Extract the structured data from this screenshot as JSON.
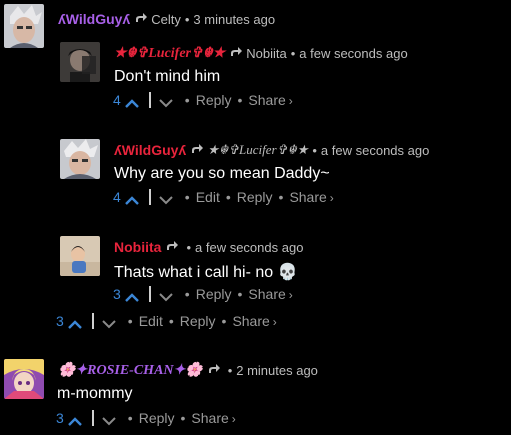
{
  "colors": {
    "accent_purple": "#a860e8",
    "accent_red": "#e8243c",
    "vote_blue": "#3b86d6",
    "meta_gray": "#bdbdbd",
    "action_gray": "#9a9a9a"
  },
  "comments": [
    {
      "author": "ʎWildGuyʎ",
      "reply_to": "Celty",
      "time": "3 minutes ago"
    },
    {
      "author": "★☬✞Lucifer✞☬★",
      "reply_to": "Nobiita",
      "time": "a few seconds ago",
      "text": "Don't mind him",
      "votes": "4",
      "actions": [
        "Reply",
        "Share"
      ]
    },
    {
      "author": "ʎWildGuyʎ",
      "reply_to": "★☬✞Lucifer✞☬★",
      "time": "a few seconds ago",
      "text": "Why are you so mean Daddy~",
      "votes": "4",
      "actions": [
        "Edit",
        "Reply",
        "Share"
      ]
    },
    {
      "author": "Nobiita",
      "time": "a few seconds ago",
      "text": "Thats what i call hi- no 💀",
      "votes": "3",
      "actions": [
        "Reply",
        "Share"
      ]
    },
    {
      "votes": "3",
      "actions": [
        "Edit",
        "Reply",
        "Share"
      ]
    },
    {
      "author": "🌸✦ROSIE-CHAN✦🌸",
      "time": "2 minutes ago",
      "text": "m-mommy",
      "votes": "3",
      "actions": [
        "Reply",
        "Share"
      ]
    }
  ]
}
